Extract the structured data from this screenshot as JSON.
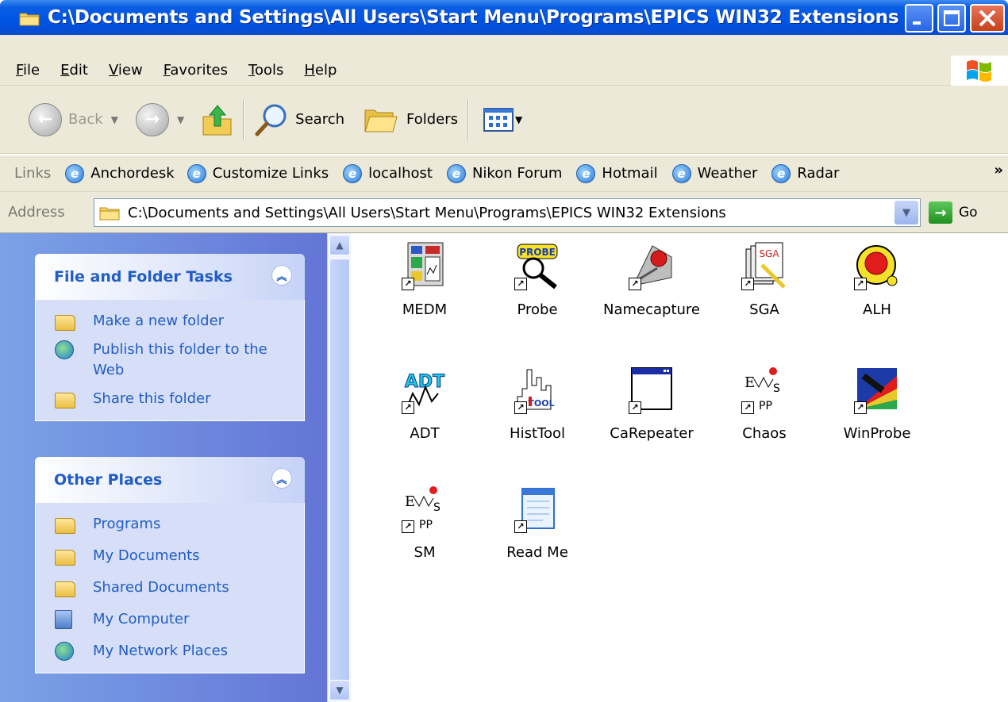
{
  "window": {
    "title": "C:\\Documents and Settings\\All Users\\Start Menu\\Programs\\EPICS WIN32 Extensions"
  },
  "menu": [
    "File",
    "Edit",
    "View",
    "Favorites",
    "Tools",
    "Help"
  ],
  "toolbar": {
    "back_label": "Back",
    "search_label": "Search",
    "folders_label": "Folders"
  },
  "links": {
    "label": "Links",
    "items": [
      "Anchordesk",
      "Customize Links",
      "localhost",
      "Nikon Forum",
      "Hotmail",
      "Weather",
      "Radar"
    ],
    "more": "»"
  },
  "address": {
    "label": "Address",
    "value": "C:\\Documents and Settings\\All Users\\Start Menu\\Programs\\EPICS WIN32 Extensions",
    "go_label": "Go"
  },
  "tasks_panel": {
    "title": "File and Folder Tasks",
    "items": [
      "Make a new folder",
      "Publish this folder to the Web",
      "Share this folder"
    ]
  },
  "places_panel": {
    "title": "Other Places",
    "items": [
      "Programs",
      "My Documents",
      "Shared Documents",
      "My Computer",
      "My Network Places"
    ]
  },
  "files": [
    "MEDM",
    "Probe",
    "Namecapture",
    "SGA",
    "ALH",
    "ADT",
    "HistTool",
    "CaRepeater",
    "Chaos",
    "WinProbe",
    "SM",
    "Read Me"
  ],
  "colors": {
    "titlebar": "#0054e3",
    "taskpane_link": "#215dc6",
    "chrome": "#ece9d8"
  }
}
